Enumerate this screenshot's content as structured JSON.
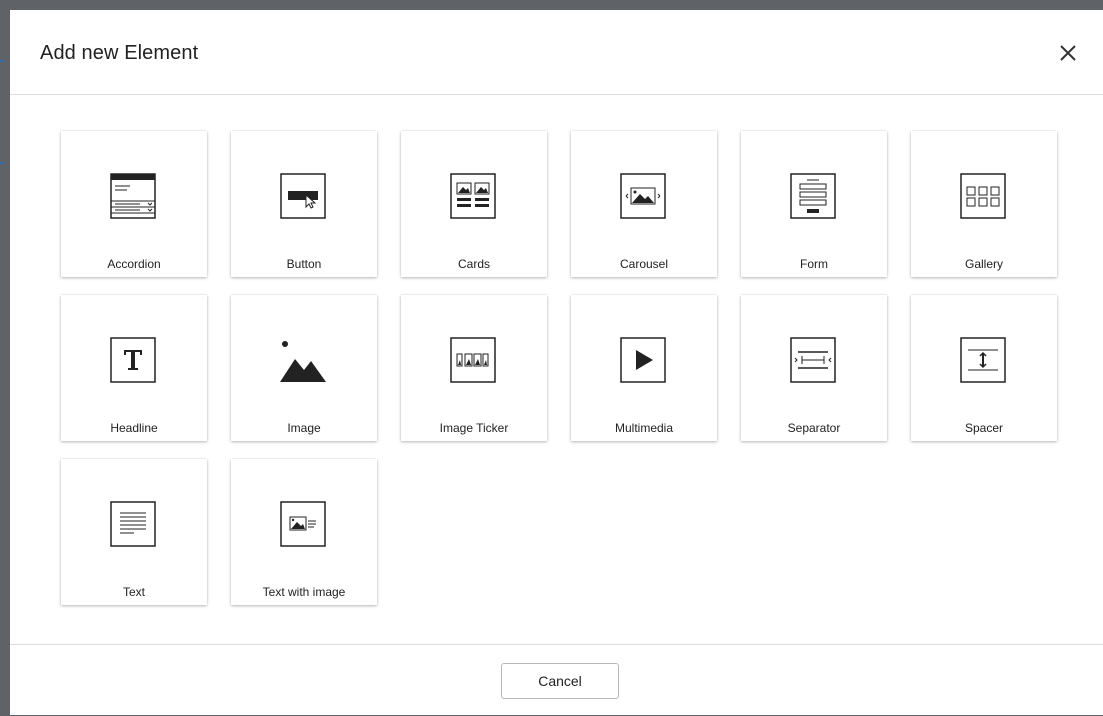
{
  "dialog": {
    "title": "Add new Element",
    "cancel_label": "Cancel"
  },
  "elements": [
    {
      "label": "Accordion",
      "icon": "accordion-icon"
    },
    {
      "label": "Button",
      "icon": "button-icon"
    },
    {
      "label": "Cards",
      "icon": "cards-icon"
    },
    {
      "label": "Carousel",
      "icon": "carousel-icon"
    },
    {
      "label": "Form",
      "icon": "form-icon"
    },
    {
      "label": "Gallery",
      "icon": "gallery-icon"
    },
    {
      "label": "Headline",
      "icon": "headline-icon"
    },
    {
      "label": "Image",
      "icon": "image-icon"
    },
    {
      "label": "Image Ticker",
      "icon": "image-ticker-icon"
    },
    {
      "label": "Multimedia",
      "icon": "multimedia-icon"
    },
    {
      "label": "Separator",
      "icon": "separator-icon"
    },
    {
      "label": "Spacer",
      "icon": "spacer-icon"
    },
    {
      "label": "Text",
      "icon": "text-icon"
    },
    {
      "label": "Text with image",
      "icon": "text-with-image-icon"
    }
  ]
}
